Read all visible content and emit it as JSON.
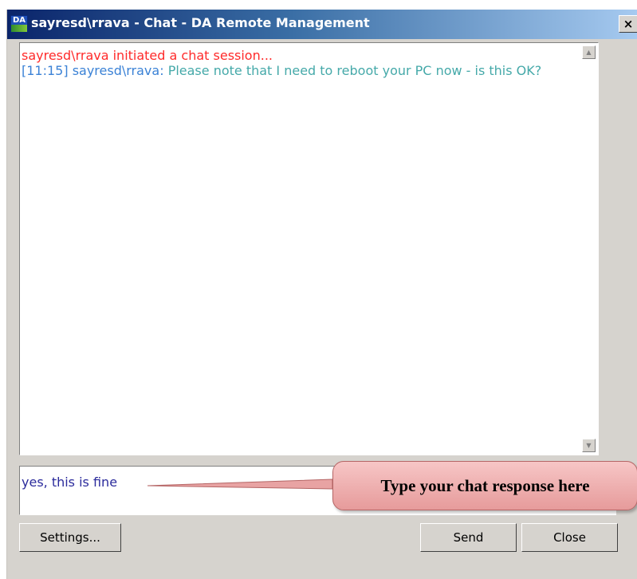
{
  "window": {
    "title": "sayresd\\rrava - Chat - DA Remote Management",
    "icon_label": "DA",
    "close_glyph": "×"
  },
  "transcript": {
    "system_message": "sayresd\\rrava initiated a chat session...",
    "messages": [
      {
        "timestamp": "[11:15]",
        "sender": "sayresd\\rrava:",
        "text": "Please note that I need to reboot your PC now - is this OK?"
      }
    ]
  },
  "input": {
    "value": "yes, this is fine"
  },
  "callout": {
    "text": "Type your chat response here"
  },
  "buttons": {
    "settings": "Settings...",
    "send": "Send",
    "close": "Close"
  },
  "colors": {
    "system_message": "#ff2a2a",
    "message_meta": "#3b82d6",
    "message_text": "#45a9a9",
    "input_text": "#2b2b9c",
    "callout_fill": "#eeafaf"
  }
}
